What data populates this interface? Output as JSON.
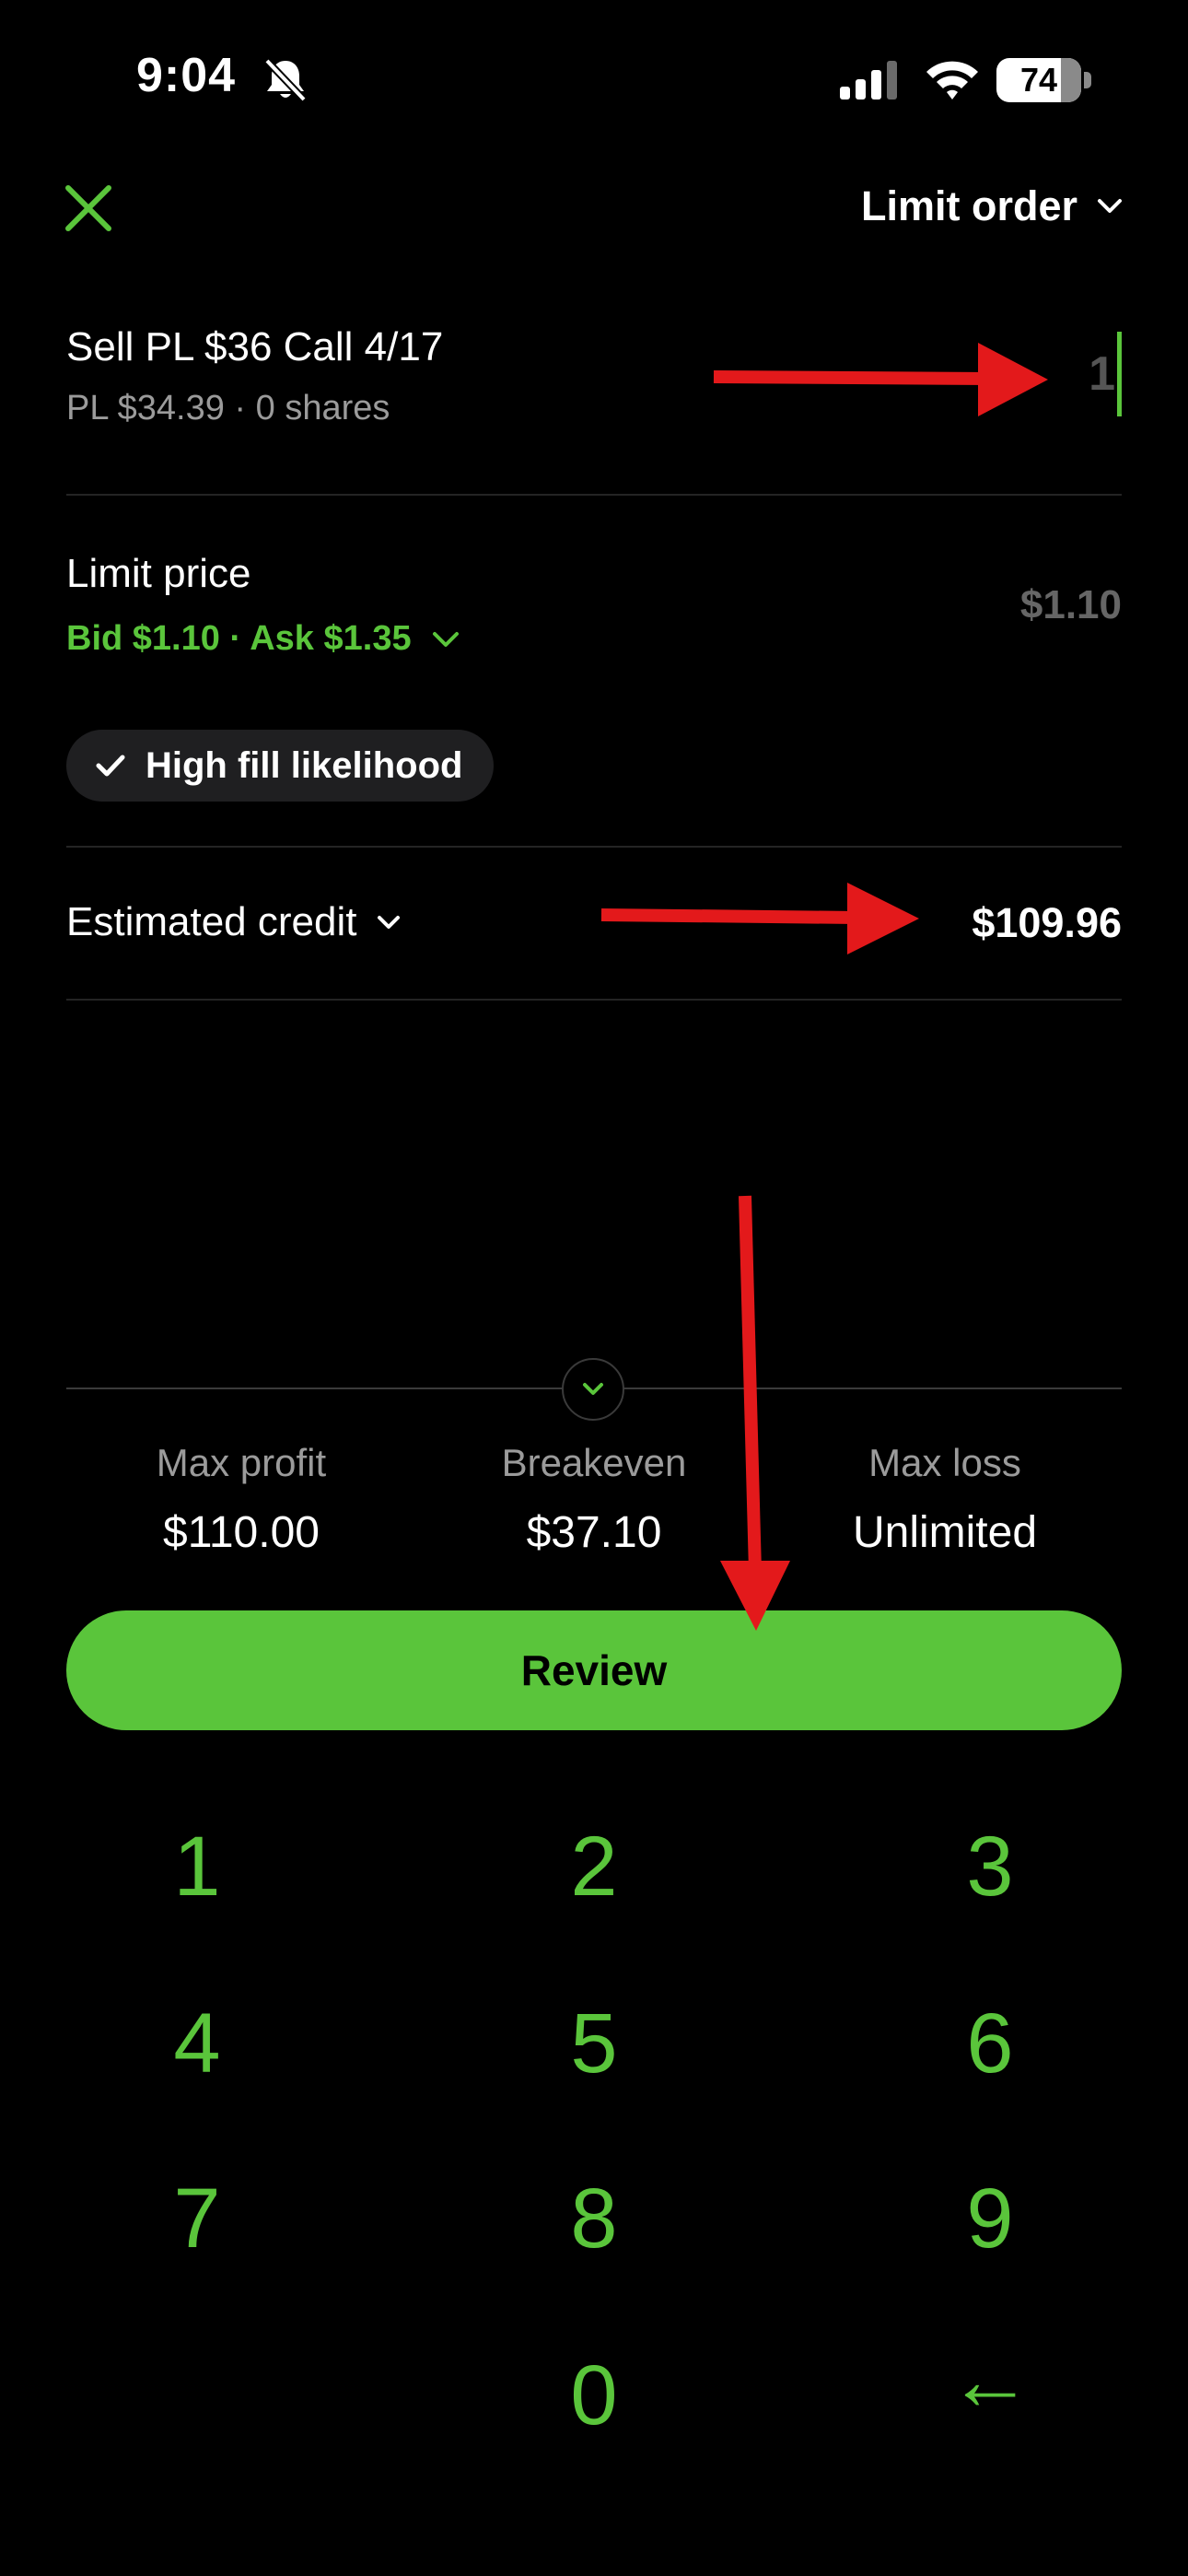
{
  "status_bar": {
    "time": "9:04",
    "battery": "74",
    "icons": [
      "bell-slash-icon",
      "cellular-signal-icon",
      "wifi-icon",
      "battery-icon"
    ]
  },
  "header": {
    "close_icon": "close-icon",
    "order_type": "Limit order"
  },
  "option": {
    "title": "Sell PL $36 Call 4/17",
    "subtitle": "PL $34.39 · 0 shares",
    "quantity": "1"
  },
  "limit_price": {
    "label": "Limit price",
    "bid_ask": "Bid $1.10 · Ask $1.35",
    "value": "$1.10"
  },
  "fill_badge": "High fill likelihood",
  "estimated_credit": {
    "label": "Estimated credit",
    "value": "$109.96"
  },
  "summary": {
    "max_profit_label": "Max profit",
    "max_profit": "$110.00",
    "breakeven_label": "Breakeven",
    "breakeven": "$37.10",
    "max_loss_label": "Max loss",
    "max_loss": "Unlimited"
  },
  "review_label": "Review",
  "keypad": [
    "1",
    "2",
    "3",
    "4",
    "5",
    "6",
    "7",
    "8",
    "9",
    "0",
    "←"
  ],
  "colors": {
    "accent": "#5ac53b",
    "background": "#000000",
    "muted_text": "#9b9b9b",
    "annotation": "#e3191b"
  }
}
